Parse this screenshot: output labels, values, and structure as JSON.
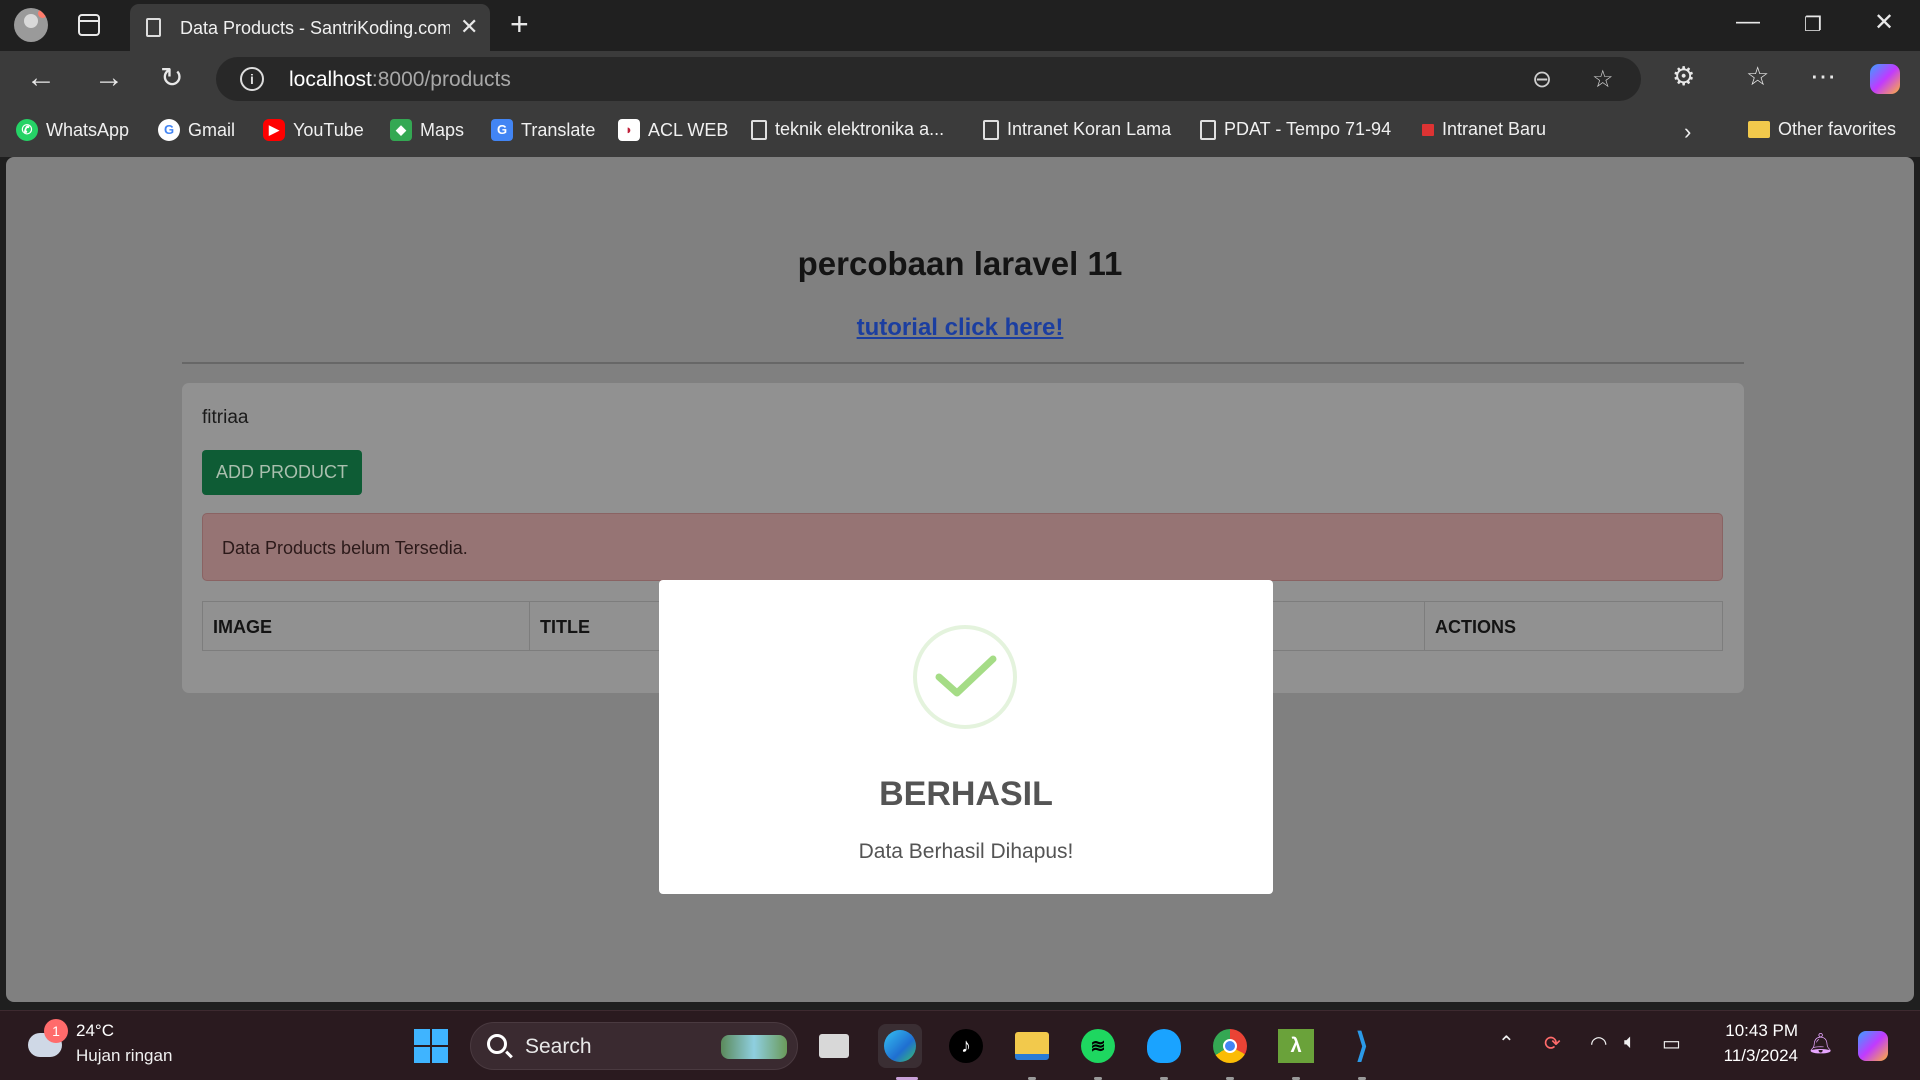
{
  "browser": {
    "tab_title": "Data Products - SantriKoding.com",
    "url_host": "localhost",
    "url_path": ":8000/products",
    "bookmarks": [
      {
        "label": "WhatsApp"
      },
      {
        "label": "Gmail"
      },
      {
        "label": "YouTube"
      },
      {
        "label": "Maps"
      },
      {
        "label": "Translate"
      },
      {
        "label": "ACL WEB"
      },
      {
        "label": "teknik elektronika a..."
      },
      {
        "label": "Intranet Koran Lama"
      },
      {
        "label": "PDAT - Tempo 71-94"
      },
      {
        "label": "Intranet Baru"
      },
      {
        "label": "Other favorites"
      }
    ]
  },
  "page": {
    "heading": "percobaan laravel 11",
    "link": "tutorial click here!",
    "username": "fitriaa",
    "add_button": "ADD PRODUCT",
    "alert": "Data Products belum Tersedia.",
    "columns": [
      "IMAGE",
      "TITLE",
      "",
      "",
      "ACTIONS"
    ]
  },
  "modal": {
    "title": "BERHASIL",
    "message": "Data Berhasil Dihapus!"
  },
  "taskbar": {
    "weather_badge": "1",
    "temperature": "24°C",
    "weather": "Hujan ringan",
    "search_label": "Search",
    "time": "10:43 PM",
    "date": "11/3/2024"
  },
  "colors": {
    "add_button": "#0e5c35",
    "alert_bg": "#967474",
    "check": "#a5dc86",
    "link": "#1b3ea0"
  }
}
